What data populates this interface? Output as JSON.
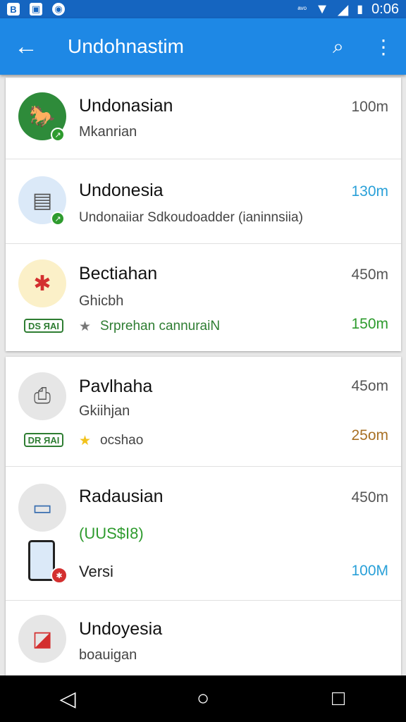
{
  "status_bar": {
    "left_icons": [
      "b-icon",
      "photo-icon",
      "messenger-icon"
    ],
    "signal_text": "ᵃᵛᵒ",
    "time": "0:06"
  },
  "app_bar": {
    "back_glyph": "←",
    "title": "Undohnastim",
    "search_glyph": "⌕",
    "more_glyph": "⋮"
  },
  "items": [
    {
      "name": "Undonasian",
      "sub": "Mkanrian",
      "time": "100m"
    },
    {
      "name": "Undonesia",
      "sub": "Undonaiiar Sdkoudoadder (ianinnsiia)",
      "time": "130m"
    },
    {
      "name": "Bectiahan",
      "sub": "Ghicbh",
      "time": "450m",
      "pill": "DS ЯAI",
      "extra": "Srprehan cannuraiN",
      "extra_time": "150m"
    },
    {
      "name": "Pavlhaha",
      "sub": "Gkiihjan",
      "time": "45om",
      "pill": "DR ЯAI",
      "extra": "ocshao",
      "extra_time": "25om"
    },
    {
      "name": "Radausian",
      "sub": "(UUS$I8)",
      "time": "450m",
      "extra": "Versi",
      "extra_time": "100M"
    },
    {
      "name": "Undoyesia",
      "sub": "boauigan"
    }
  ],
  "colors": {
    "appbar": "#1e88e5",
    "statusbar": "#1565c0",
    "time_blue": "#29a0d8",
    "time_green": "#2e9b2e",
    "time_brown": "#a87024",
    "price_green": "#2e7d32"
  },
  "nav": {
    "back": "◁",
    "home": "○",
    "recents": "□"
  }
}
